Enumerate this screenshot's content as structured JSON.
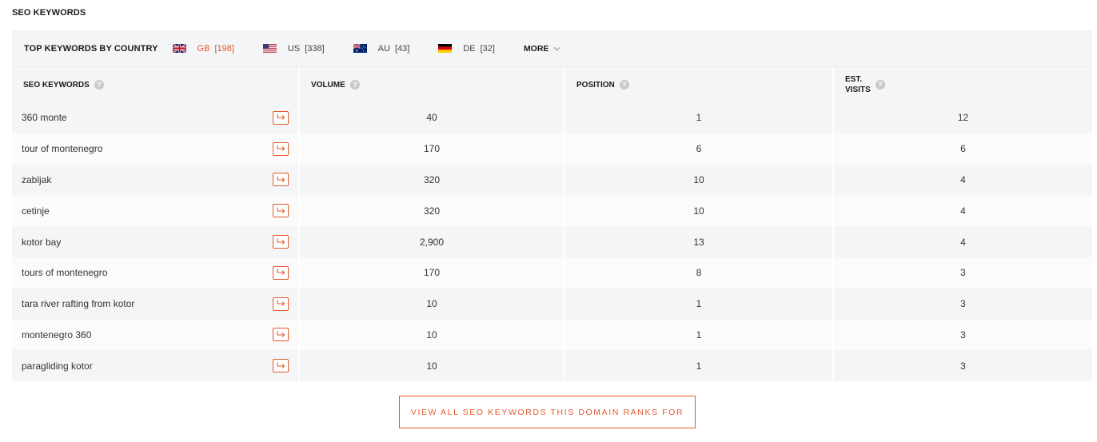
{
  "section_title": "SEO KEYWORDS",
  "country_bar": {
    "title": "TOP KEYWORDS BY COUNTRY",
    "countries": [
      {
        "code": "GB",
        "count": "[198]",
        "flag": "uk-flag",
        "active": true
      },
      {
        "code": "US",
        "count": "[338]",
        "flag": "us-flag",
        "active": false
      },
      {
        "code": "AU",
        "count": "[43]",
        "flag": "au-flag",
        "active": false
      },
      {
        "code": "DE",
        "count": "[32]",
        "flag": "de-flag",
        "active": false
      }
    ],
    "more_label": "MORE"
  },
  "table": {
    "headers": {
      "keyword": "SEO KEYWORDS",
      "volume": "VOLUME",
      "position": "POSITION",
      "visits_line1": "EST.",
      "visits_line2": "VISITS"
    },
    "rows": [
      {
        "keyword": "360 monte",
        "volume": "40",
        "position": "1",
        "visits": "12"
      },
      {
        "keyword": "tour of montenegro",
        "volume": "170",
        "position": "6",
        "visits": "6"
      },
      {
        "keyword": "zabljak",
        "volume": "320",
        "position": "10",
        "visits": "4"
      },
      {
        "keyword": "cetinje",
        "volume": "320",
        "position": "10",
        "visits": "4"
      },
      {
        "keyword": "kotor bay",
        "volume": "2,900",
        "position": "13",
        "visits": "4"
      },
      {
        "keyword": "tours of montenegro",
        "volume": "170",
        "position": "8",
        "visits": "3"
      },
      {
        "keyword": "tara river rafting from kotor",
        "volume": "10",
        "position": "1",
        "visits": "3"
      },
      {
        "keyword": "montenegro 360",
        "volume": "10",
        "position": "1",
        "visits": "3"
      },
      {
        "keyword": "paragliding kotor",
        "volume": "10",
        "position": "1",
        "visits": "3"
      }
    ]
  },
  "view_all_label": "VIEW ALL SEO KEYWORDS THIS DOMAIN RANKS FOR",
  "colors": {
    "accent": "#e3592d",
    "row_bg": "#f4f5f6",
    "row_alt_bg": "#fbfbfc"
  }
}
